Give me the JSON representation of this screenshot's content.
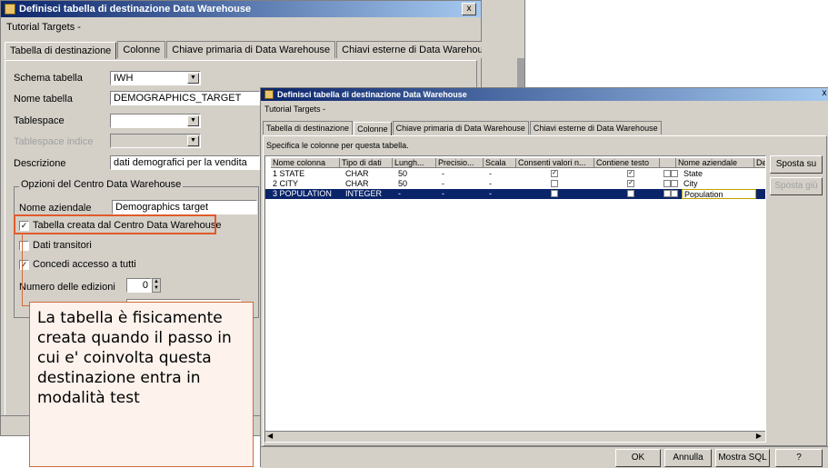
{
  "back_window": {
    "title": "Definisci tabella di destinazione Data Warehouse",
    "close_label": "x",
    "subtitle": "Tutorial Targets -",
    "tabs": [
      {
        "label": "Tabella di destinazione"
      },
      {
        "label": "Colonne"
      },
      {
        "label": "Chiave primaria di Data Warehouse"
      },
      {
        "label": "Chiavi esterne di Data Warehouse"
      }
    ],
    "schema_label": "Schema tabella",
    "schema_value": "IWH",
    "name_label": "Nome tabella",
    "name_value": "DEMOGRAPHICS_TARGET",
    "tablespace_label": "Tablespace",
    "tablespace_value": "",
    "index_tablespace_label": "Tablespace indice",
    "index_tablespace_value": "",
    "description_label": "Descrizione",
    "description_value": "dati demografici per la vendita",
    "options_group": "Opzioni del Centro Data Warehouse",
    "business_name_label": "Nome aziendale",
    "business_name_value": "Demographics target",
    "cb_created": {
      "label": "Tabella creata dal Centro Data Warehouse",
      "checked": "✓"
    },
    "cb_transient": {
      "label": "Dati transitori",
      "checked": ""
    },
    "cb_grant": {
      "label": "Concedi accesso a tutti",
      "checked": "✓"
    },
    "editions_label": "Numero delle edizioni",
    "editions_value": "0"
  },
  "callout": {
    "text": "La tabella è fisicamente creata quando il passo in cui e' coinvolta questa destinazione entra in modalità test"
  },
  "front_window": {
    "title": "Definisci tabella di destinazione Data Warehouse",
    "close_label": "x",
    "subtitle": "Tutorial Targets -",
    "tabs": [
      {
        "label": "Tabella di destinazione"
      },
      {
        "label": "Colonne"
      },
      {
        "label": "Chiave primaria di Data Warehouse"
      },
      {
        "label": "Chiavi esterne di Data Warehouse"
      }
    ],
    "instruction": "Specifica le colonne per questa tabella.",
    "grid": {
      "columns": [
        "Nome colonna",
        "Tipo di dati",
        "Lungh...",
        "Precisio...",
        "Scala",
        "Consenti valori n...",
        "Contiene testo",
        "",
        "Nome aziendale",
        "De"
      ],
      "rows": [
        {
          "name": "1 STATE",
          "type": "CHAR",
          "length": "50",
          "precision": "-",
          "scale": "-",
          "nullable": "✓",
          "text": "✓",
          "business": "State"
        },
        {
          "name": "2 CITY",
          "type": "CHAR",
          "length": "50",
          "precision": "-",
          "scale": "-",
          "nullable": "",
          "text": "✓",
          "business": "City"
        },
        {
          "name": "3 POPULATION",
          "type": "INTEGER",
          "length": "-",
          "precision": "-",
          "scale": "-",
          "nullable": "",
          "text": "",
          "business": "Population"
        }
      ]
    },
    "buttons": {
      "move_up": "Sposta su",
      "move_down": "Sposta giù",
      "ok": "OK",
      "cancel": "Annulla",
      "show_sql": "Mostra SQL",
      "help": "?"
    }
  }
}
